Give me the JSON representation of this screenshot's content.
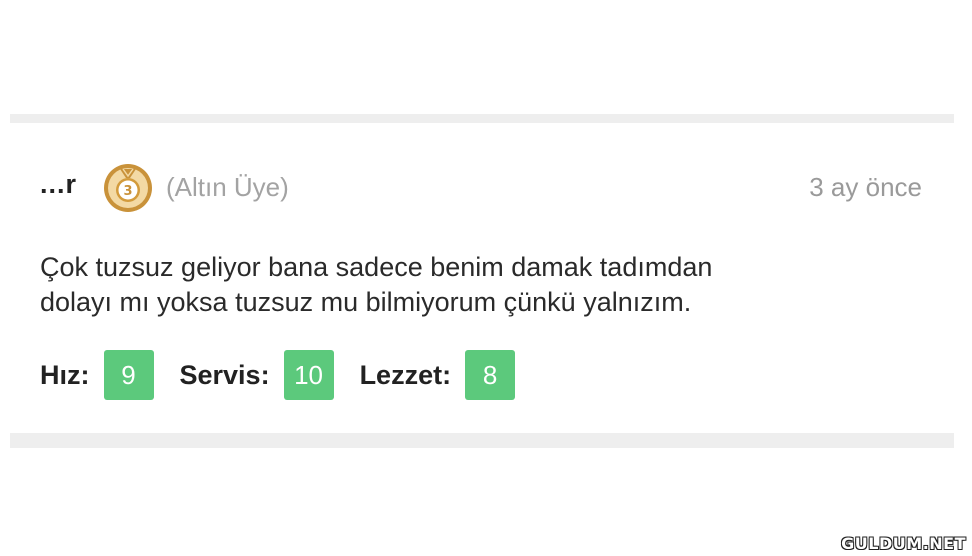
{
  "review": {
    "username": "...r",
    "badge_icon": "gold-medal-3-icon",
    "badge_number": "3",
    "badge_color": "#c9923a",
    "member_level": "(Altın Üye)",
    "time_ago": "3 ay önce",
    "comment_line1": "Çok tuzsuz geliyor bana sadece benim damak tadımdan",
    "comment_line2": "dolayı mı yoksa tuzsuz mu bilmiyorum çünkü yalnızım.",
    "ratings": [
      {
        "label": "Hız:",
        "score": "9"
      },
      {
        "label": "Servis:",
        "score": "10"
      },
      {
        "label": "Lezzet:",
        "score": "8"
      }
    ],
    "score_color": "#5cc97c"
  },
  "watermark": "GULDUM.NET"
}
